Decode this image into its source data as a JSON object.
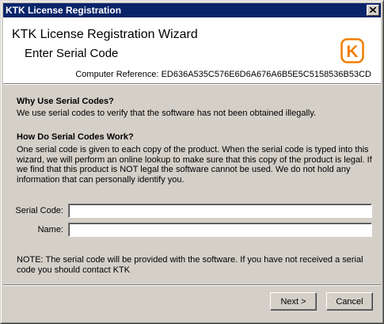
{
  "window": {
    "title": "KTK License Registration"
  },
  "header": {
    "title": "KTK License Registration Wizard",
    "subtitle": "Enter Serial Code",
    "computer_reference": "Computer Reference: ED636A535C576E6D6A676A6B5E5C5158536B53CD",
    "logo_letter": "K",
    "logo_color": "#f07e00"
  },
  "body": {
    "why_heading": "Why Use Serial Codes?",
    "why_text": "We use serial codes to verify that the software has not been obtained illegally.",
    "how_heading": "How Do Serial Codes Work?",
    "how_text": "One serial code is given to each copy of the product. When the serial code is typed into this wizard, we will perform an online lookup to make sure that this copy of the product is legal. If we find that this product is NOT legal the software cannot be used. We do not hold any information that can personally identify you.",
    "serial_label": "Serial Code:",
    "serial_value": "",
    "name_label": "Name:",
    "name_value": "",
    "note": "NOTE: The serial code will be provided with the software. If you have not received a serial code you should contact KTK"
  },
  "buttons": {
    "next": "Next >",
    "cancel": "Cancel"
  }
}
